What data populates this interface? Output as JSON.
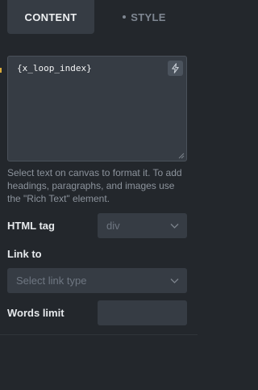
{
  "tabs": {
    "content_label": "CONTENT",
    "style_label": "STYLE"
  },
  "editor": {
    "value": "{x_loop_index}",
    "dynamic_icon": "bolt-icon",
    "help_text": "Select text on canvas to format it. To add headings, paragraphs, and images use the \"Rich Text\" element."
  },
  "html_tag": {
    "label": "HTML tag",
    "selected": "div"
  },
  "link_to": {
    "label": "Link to",
    "placeholder": "Select link type"
  },
  "words_limit": {
    "label": "Words limit",
    "value": ""
  },
  "colors": {
    "panel_bg": "#23272c",
    "control_bg": "#363c44",
    "accent_marker": "#d8a93a"
  }
}
